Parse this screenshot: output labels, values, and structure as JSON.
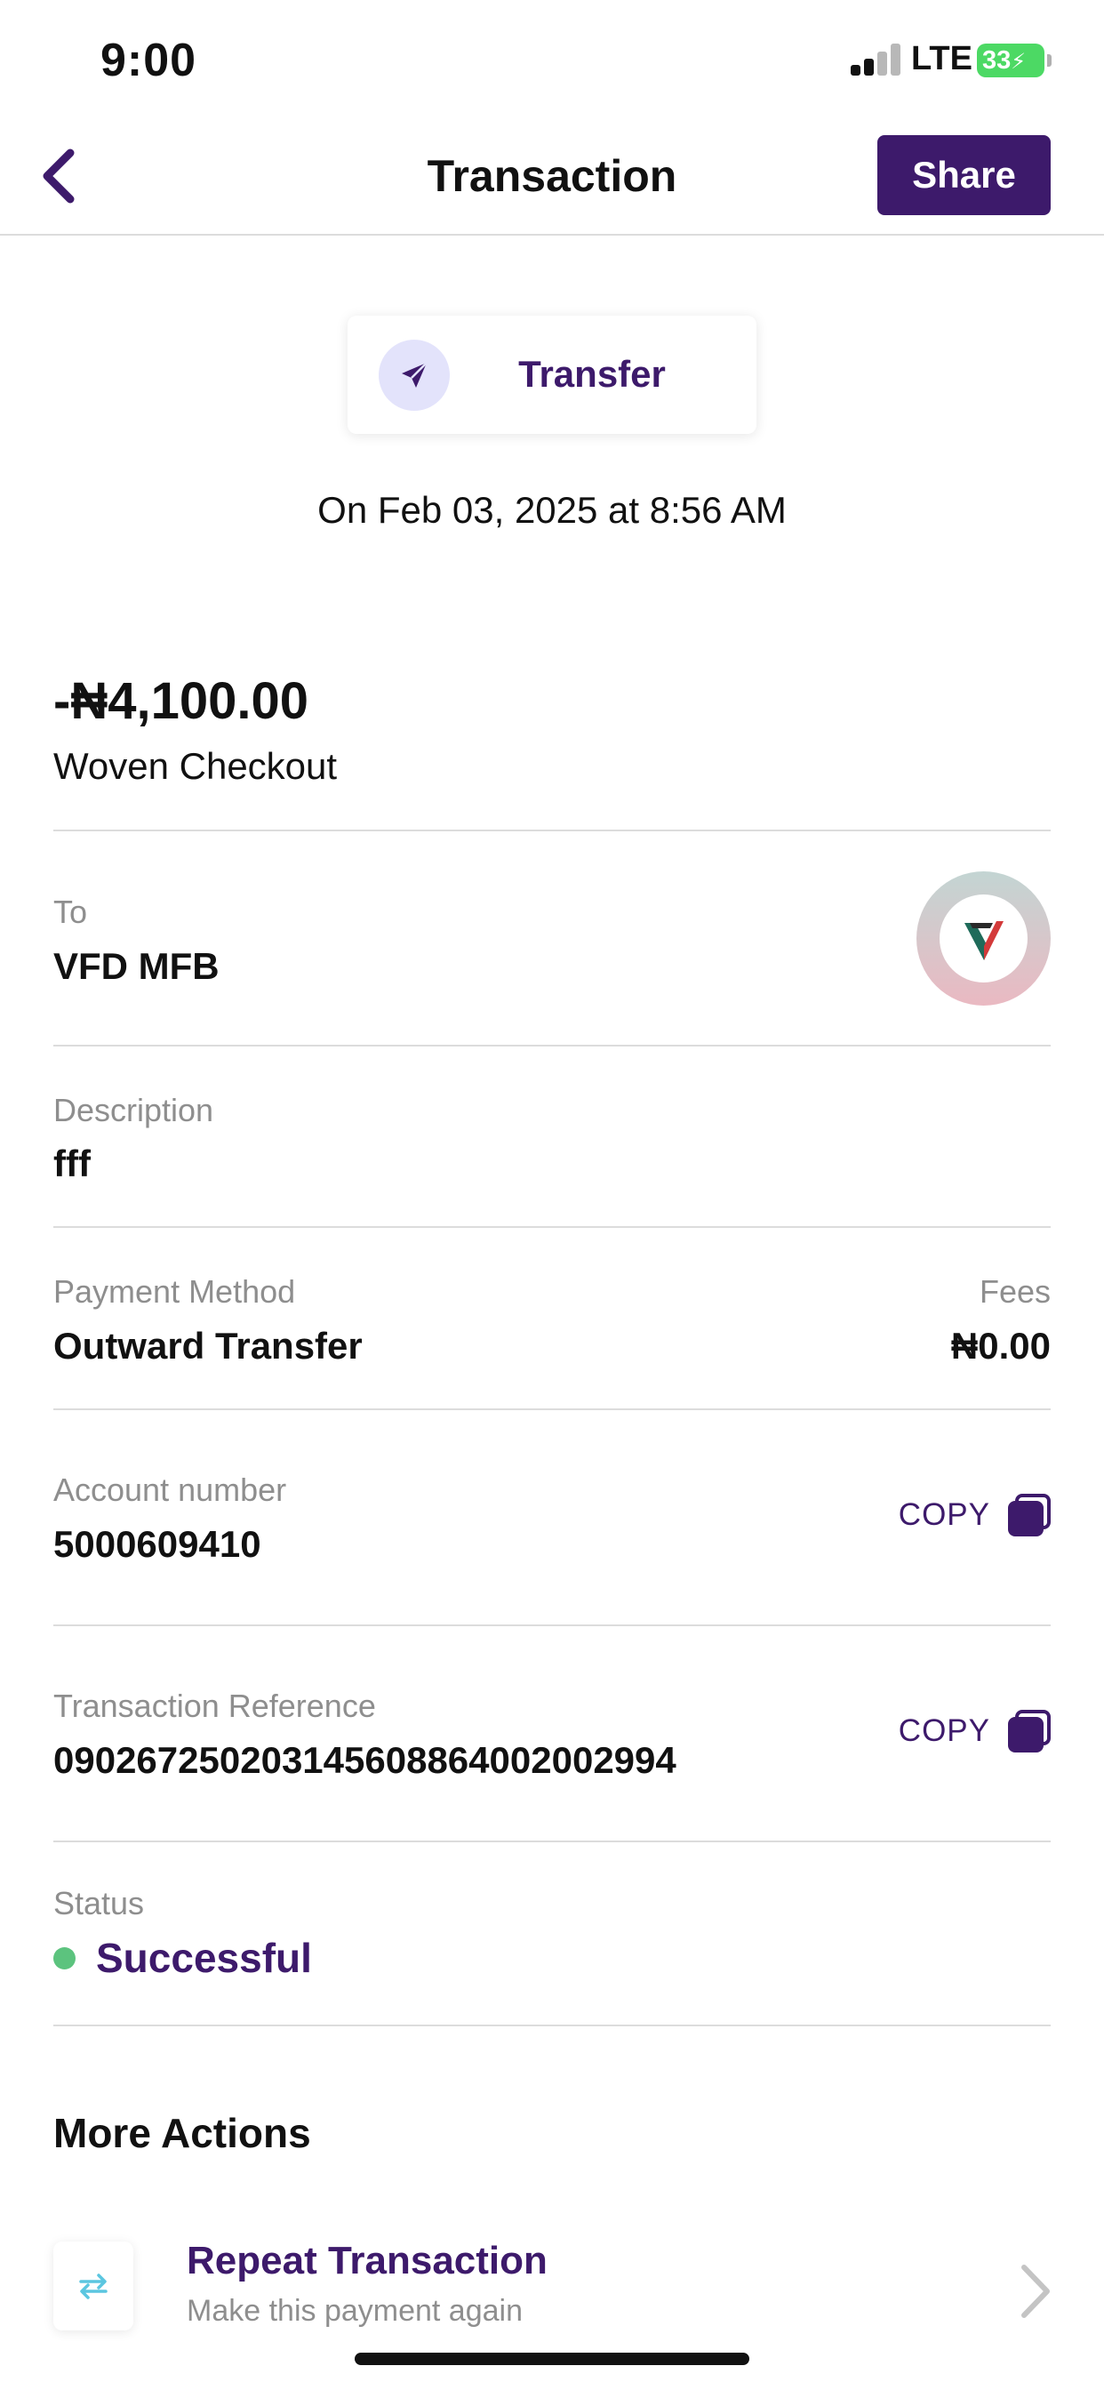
{
  "status_bar": {
    "time": "9:00",
    "network": "LTE",
    "battery": "33"
  },
  "header": {
    "title": "Transaction",
    "share_label": "Share"
  },
  "type_chip": {
    "label": "Transfer",
    "icon": "send-arrow-icon"
  },
  "date_text": "On Feb 03, 2025 at 8:56 AM",
  "amount": "-₦4,100.00",
  "merchant": "Woven Checkout",
  "recipient": {
    "label": "To",
    "value": "VFD MFB",
    "logo": "vfd-bank-logo"
  },
  "description": {
    "label": "Description",
    "value": "fff"
  },
  "payment_method": {
    "label": "Payment Method",
    "value": "Outward Transfer"
  },
  "fees": {
    "label": "Fees",
    "value": "₦0.00"
  },
  "account_number": {
    "label": "Account number",
    "value": "5000609410",
    "copy_label": "COPY"
  },
  "reference": {
    "label": "Transaction Reference",
    "value": "090267250203145608864002002994",
    "copy_label": "COPY"
  },
  "status": {
    "label": "Status",
    "value": "Successful",
    "color": "#5cc37e"
  },
  "more_actions": {
    "title": "More Actions",
    "items": [
      {
        "title": "Repeat Transaction",
        "subtitle": "Make this payment again",
        "icon": "repeat-icon"
      }
    ]
  },
  "colors": {
    "brand": "#3d1a6b",
    "success": "#5cc37e",
    "muted": "#8e8e8e"
  }
}
